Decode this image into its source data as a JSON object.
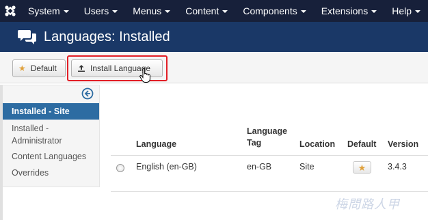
{
  "navbar": {
    "menu": [
      {
        "label": "System"
      },
      {
        "label": "Users"
      },
      {
        "label": "Menus"
      },
      {
        "label": "Content"
      },
      {
        "label": "Components"
      },
      {
        "label": "Extensions"
      },
      {
        "label": "Help"
      }
    ]
  },
  "header": {
    "title": "Languages: Installed"
  },
  "toolbar": {
    "default_label": "Default",
    "install_label": "Install Language"
  },
  "sidebar": {
    "items": [
      {
        "label": "Installed - Site"
      },
      {
        "label": "Installed -"
      },
      {
        "label": "Administrator"
      },
      {
        "label": "Content Languages"
      },
      {
        "label": "Overrides"
      }
    ]
  },
  "table": {
    "headers": {
      "language": "Language",
      "tag_line1": "Language",
      "tag_line2": "Tag",
      "location": "Location",
      "default": "Default",
      "version": "Version"
    },
    "rows": [
      {
        "language": "English (en-GB)",
        "tag": "en-GB",
        "location": "Site",
        "version": "3.4.3"
      }
    ]
  },
  "watermark": "梅問路人甲",
  "colors": {
    "navbar_bg": "#17203a",
    "header_bg": "#1a3867",
    "active_item": "#2d6ca2",
    "highlight": "#e21e26",
    "star": "#e0a03a"
  }
}
